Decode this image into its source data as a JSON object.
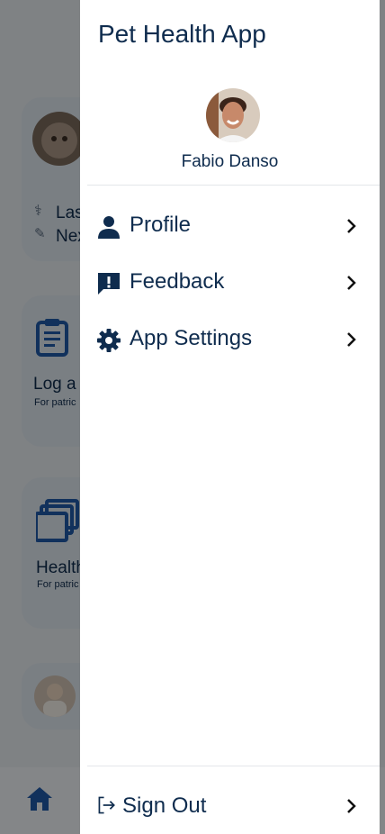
{
  "app": {
    "title": "Pet Health App"
  },
  "user": {
    "name": "Fabio Danso"
  },
  "menu": {
    "items": [
      {
        "label": "Profile",
        "icon": "person-icon"
      },
      {
        "label": "Feedback",
        "icon": "feedback-icon"
      },
      {
        "label": "App Settings",
        "icon": "gear-icon"
      }
    ],
    "signout": {
      "label": "Sign Out",
      "icon": "logout-icon"
    }
  },
  "background": {
    "card1_lines": [
      "Las",
      "Nex"
    ],
    "card2_title": "Log a",
    "card2_sub": "For patric",
    "card3_title": "Health",
    "card3_sub": "For patric"
  },
  "colors": {
    "primary": "#0f2c4e",
    "accent_icon": "#1f5aa8",
    "scrim": "rgba(0,0,0,0.45)"
  }
}
